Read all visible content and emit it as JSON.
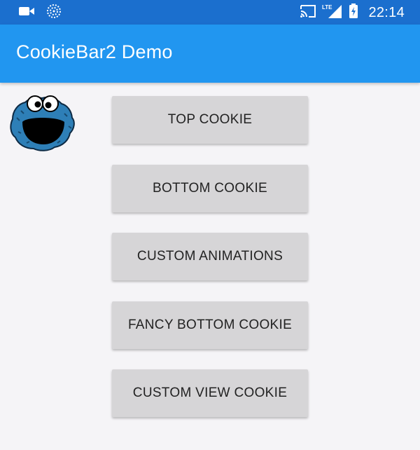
{
  "status_bar": {
    "time": "22:14",
    "network": "LTE",
    "icons": [
      "camera-icon",
      "sync-icon",
      "cast-icon",
      "lte-signal-icon",
      "battery-icon"
    ]
  },
  "app_bar": {
    "title": "CookieBar2 Demo",
    "color": "#2196f0"
  },
  "mascot": {
    "icon": "cookie-monster-icon"
  },
  "buttons": {
    "top_cookie": "TOP COOKIE",
    "bottom_cookie": "BOTTOM COOKIE",
    "custom_animations": "CUSTOM ANIMATIONS",
    "fancy_bottom_cookie": "FANCY BOTTOM COOKIE",
    "custom_view_cookie": "CUSTOM VIEW COOKIE"
  }
}
